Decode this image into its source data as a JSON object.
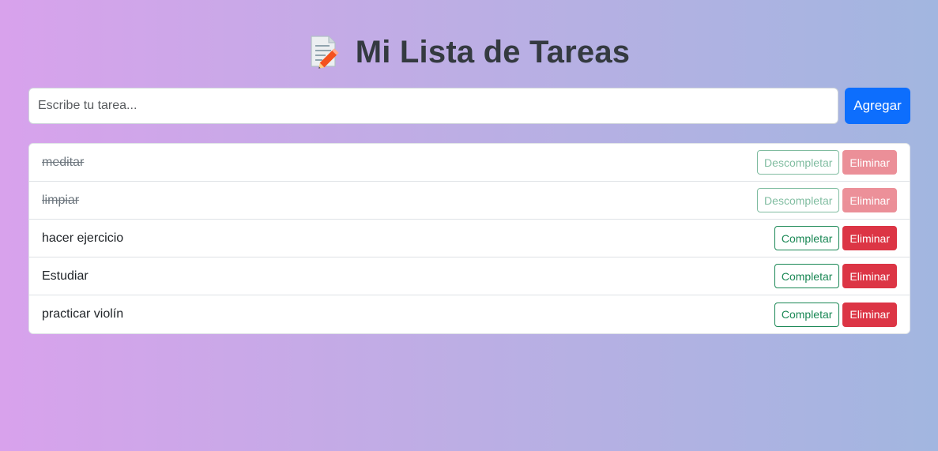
{
  "header": {
    "title": "Mi Lista de Tareas",
    "icon": "memo-icon"
  },
  "form": {
    "placeholder": "Escribe tu tarea...",
    "value": "",
    "add_label": "Agregar"
  },
  "tasks": [
    {
      "text": "meditar",
      "done": true,
      "toggle_label": "Descompletar",
      "delete_label": "Eliminar"
    },
    {
      "text": "limpiar",
      "done": true,
      "toggle_label": "Descompletar",
      "delete_label": "Eliminar"
    },
    {
      "text": "hacer ejercicio",
      "done": false,
      "toggle_label": "Completar",
      "delete_label": "Eliminar"
    },
    {
      "text": "Estudiar",
      "done": false,
      "toggle_label": "Completar",
      "delete_label": "Eliminar"
    },
    {
      "text": "practicar violín",
      "done": false,
      "toggle_label": "Completar",
      "delete_label": "Eliminar"
    }
  ],
  "colors": {
    "primary": "#0d6efd",
    "success": "#198754",
    "danger": "#dc3545",
    "title": "#343a40"
  }
}
